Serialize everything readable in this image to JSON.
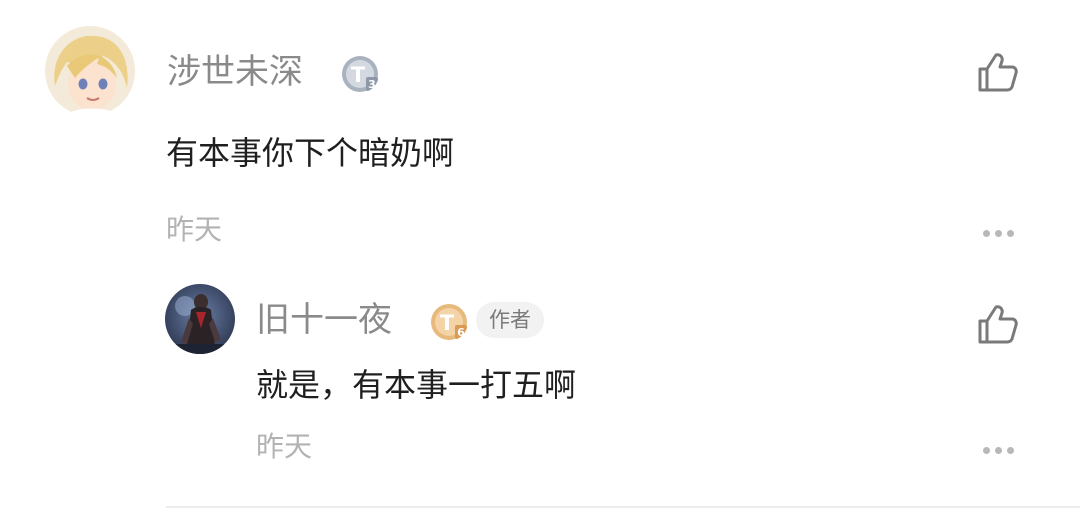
{
  "comment": {
    "username": "涉世未深",
    "level_badge": "T3",
    "text": "有本事你下个暗奶啊",
    "time": "昨天",
    "like_icon": "thumbs-up-icon",
    "more_icon": "more-dots-icon"
  },
  "reply": {
    "username": "旧十一夜",
    "level_badge": "T6",
    "author_tag": "作者",
    "text": "就是，有本事一打五啊",
    "time": "昨天",
    "like_icon": "thumbs-up-icon",
    "more_icon": "more-dots-icon"
  },
  "colors": {
    "badge_silver": "#a9b2bf",
    "badge_gold": "#e8b97c",
    "username_gray": "#8a8a8a",
    "text_dark": "#1f1f1f",
    "time_gray": "#b3b3b3"
  }
}
